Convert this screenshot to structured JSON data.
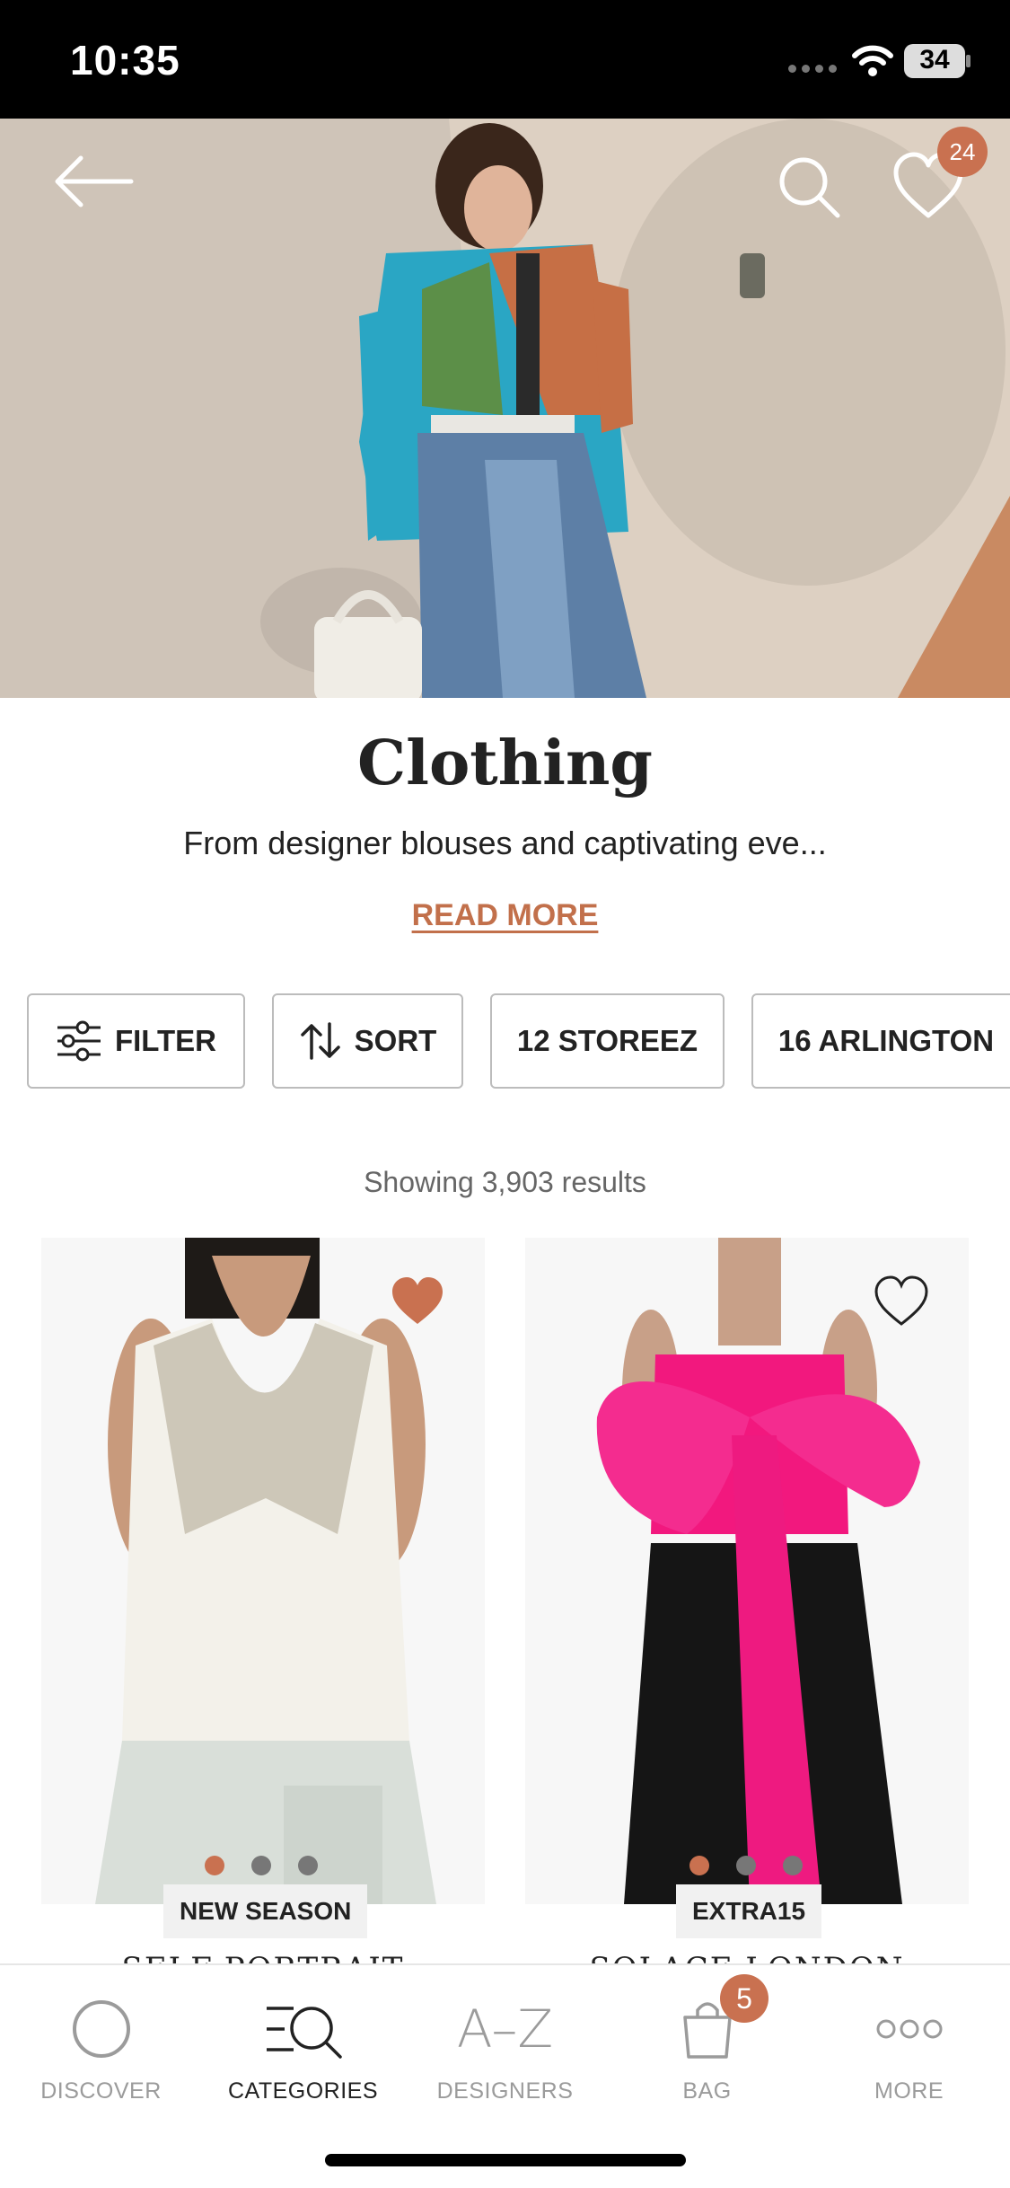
{
  "status_bar": {
    "time": "10:35",
    "battery": "34"
  },
  "header": {
    "wishlist_count": "24",
    "icons": [
      "back-arrow-icon",
      "search-icon",
      "heart-icon"
    ]
  },
  "category": {
    "title": "Clothing",
    "description": "From designer blouses and captivating eve...",
    "read_more": "READ MORE"
  },
  "chips": [
    {
      "label": "FILTER",
      "icon": "filter-icon"
    },
    {
      "label": "SORT",
      "icon": "sort-icon"
    },
    {
      "label": "12 STOREEZ"
    },
    {
      "label": "16 ARLINGTON"
    }
  ],
  "results_text": "Showing 3,903 results",
  "products": [
    {
      "tag": "NEW SEASON",
      "brand": "SELF-PORTRAIT",
      "favorited": true
    },
    {
      "tag": "EXTRA15",
      "brand": "SOLACE LONDON",
      "favorited": false
    }
  ],
  "tabs": [
    {
      "label": "DISCOVER",
      "icon": "discover-circle-icon"
    },
    {
      "label": "CATEGORIES",
      "icon": "categories-search-icon",
      "active": true
    },
    {
      "label": "DESIGNERS",
      "icon": "a-z-icon",
      "icon_text": "A–Z"
    },
    {
      "label": "BAG",
      "icon": "bag-icon",
      "badge": "5"
    },
    {
      "label": "MORE",
      "icon": "more-dots-icon"
    }
  ],
  "colors": {
    "accent": "#c97150",
    "link": "#c2704b",
    "status_bar": "#000000"
  }
}
